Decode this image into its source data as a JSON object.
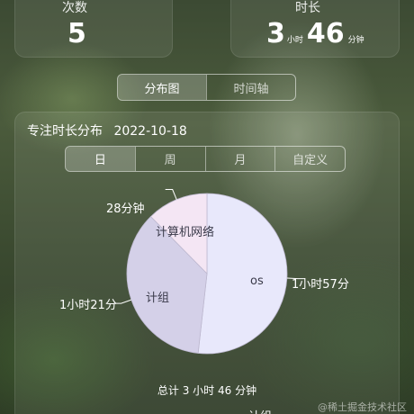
{
  "stats": {
    "count_label": "次数",
    "count_value": "5",
    "duration_label": "时长",
    "duration_hours": "3",
    "duration_hours_unit": "小时",
    "duration_minutes": "46",
    "duration_minutes_unit": "分钟"
  },
  "view_tabs": [
    {
      "label": "分布图",
      "active": true
    },
    {
      "label": "时间轴",
      "active": false
    }
  ],
  "distribution": {
    "title": "专注时长分布",
    "date": "2022-10-18",
    "period_tabs": [
      {
        "label": "日",
        "active": true
      },
      {
        "label": "周",
        "active": false
      },
      {
        "label": "月",
        "active": false
      },
      {
        "label": "自定义",
        "active": false
      }
    ],
    "total_text": "总计 3 小时 46 分钟"
  },
  "chart_data": {
    "type": "pie",
    "slices": [
      {
        "name": "os",
        "value_label": "1小时57分",
        "minutes": 117,
        "color": "#e8e8fb"
      },
      {
        "name": "计组",
        "value_label": "1小时21分",
        "minutes": 81,
        "color": "#d4d0e8"
      },
      {
        "name": "计算机网络",
        "value_label": "28分钟",
        "minutes": 28,
        "color": "#f4e6f4"
      }
    ]
  },
  "bottom_partial_text": "计组",
  "watermark": "@稀土掘金技术社区"
}
